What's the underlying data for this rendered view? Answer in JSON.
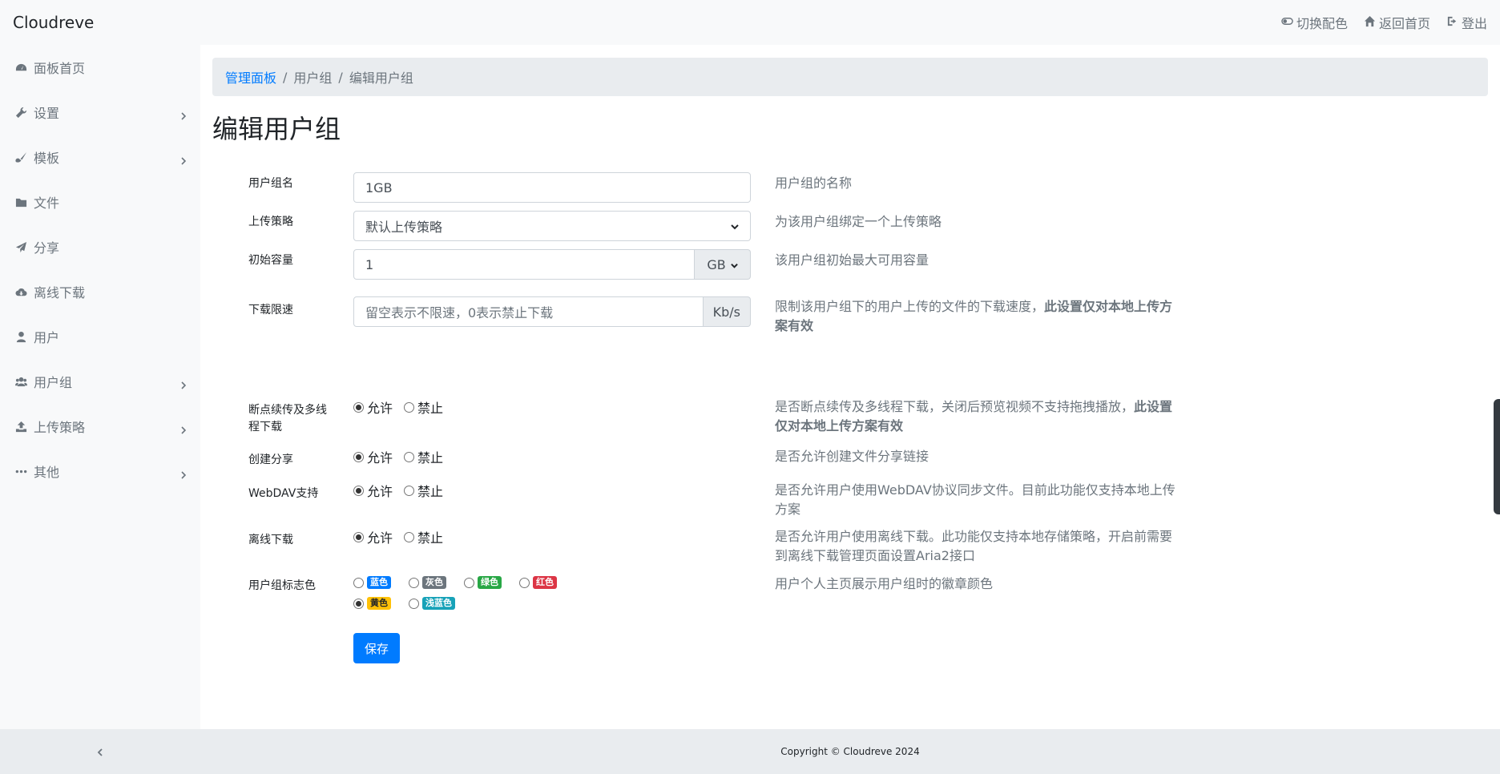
{
  "navbar": {
    "brand": "Cloudreve",
    "toggle_theme": "切换配色",
    "home": "返回首页",
    "logout": "登出"
  },
  "sidebar": {
    "items": [
      {
        "label": "面板首页",
        "icon": "tachometer-icon",
        "has_children": false
      },
      {
        "label": "设置",
        "icon": "wrench-icon",
        "has_children": true
      },
      {
        "label": "模板",
        "icon": "paint-brush-icon",
        "has_children": true
      },
      {
        "label": "文件",
        "icon": "folder-icon",
        "has_children": false
      },
      {
        "label": "分享",
        "icon": "paper-plane-icon",
        "has_children": false
      },
      {
        "label": "离线下载",
        "icon": "cloud-download-icon",
        "has_children": false
      },
      {
        "label": "用户",
        "icon": "user-icon",
        "has_children": false
      },
      {
        "label": "用户组",
        "icon": "users-icon",
        "has_children": true
      },
      {
        "label": "上传策略",
        "icon": "upload-icon",
        "has_children": true
      },
      {
        "label": "其他",
        "icon": "ellipsis-icon",
        "has_children": true
      }
    ]
  },
  "breadcrumb": {
    "items": [
      "管理面板",
      "用户组",
      "编辑用户组"
    ]
  },
  "page_title": "编辑用户组",
  "form": {
    "group_name": {
      "label": "用户组名",
      "value": "1GB",
      "help": "用户组的名称"
    },
    "policy": {
      "label": "上传策略",
      "value": "默认上传策略",
      "help": "为该用户组绑定一个上传策略"
    },
    "capacity": {
      "label": "初始容量",
      "value": "1",
      "unit": "GB",
      "help": "该用户组初始最大可用容量"
    },
    "speed": {
      "label": "下载限速",
      "placeholder": "留空表示不限速，0表示禁止下载",
      "unit": "Kb/s",
      "help": "限制该用户组下的用户上传的文件的下载速度，",
      "help_bold": "此设置仅对本地上传方案有效"
    },
    "range": {
      "label": "断点续传及多线程下载",
      "help": "是否断点续传及多线程下载，关闭后预览视频不支持拖拽播放，",
      "help_bold": "此设置仅对本地上传方案有效"
    },
    "share": {
      "label": "创建分享",
      "help": "是否允许创建文件分享链接"
    },
    "webdav": {
      "label": "WebDAV支持",
      "help": "是否允许用户使用WebDAV协议同步文件。目前此功能仅支持本地上传方案"
    },
    "aria2": {
      "label": "离线下载",
      "help": "是否允许用户使用离线下载。此功能仅支持本地存储策略，开启前需要到离线下载管理页面设置Aria2接口"
    },
    "color": {
      "label": "用户组标志色",
      "help": "用户个人主页展示用户组时的徽章颜色"
    },
    "allow": "允许",
    "deny": "禁止",
    "colors": [
      {
        "label": "蓝色",
        "hex": "#007bff",
        "selected": false,
        "text": "#ffffff"
      },
      {
        "label": "灰色",
        "hex": "#6c757d",
        "selected": false,
        "text": "#ffffff"
      },
      {
        "label": "绿色",
        "hex": "#28a745",
        "selected": false,
        "text": "#ffffff"
      },
      {
        "label": "红色",
        "hex": "#dc3545",
        "selected": false,
        "text": "#ffffff"
      },
      {
        "label": "黄色",
        "hex": "#ffc107",
        "selected": true,
        "text": "#212529"
      },
      {
        "label": "浅蓝色",
        "hex": "#17a2b8",
        "selected": false,
        "text": "#ffffff"
      }
    ],
    "save": "保存"
  },
  "footer": "Copyright © Cloudreve 2024"
}
